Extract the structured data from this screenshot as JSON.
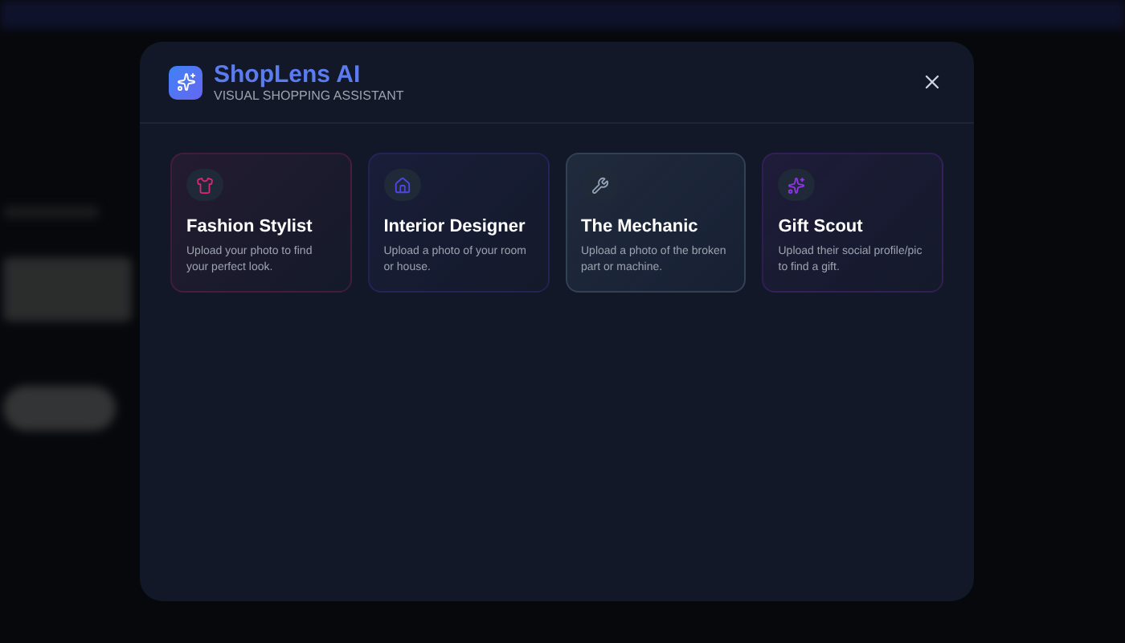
{
  "modal": {
    "title": "ShopLens AI",
    "subtitle": "VISUAL SHOPPING ASSISTANT"
  },
  "modes": [
    {
      "kind": "shirt",
      "title": "Fashion Stylist",
      "description": "Upload your photo to find your perfect look.",
      "color": "#db2777",
      "selected": false
    },
    {
      "kind": "house",
      "title": "Interior Designer",
      "description": "Upload a photo of your room or house.",
      "color": "#4f46e5",
      "selected": false
    },
    {
      "kind": "wrench",
      "title": "The Mechanic",
      "description": "Upload a photo of the broken part or machine.",
      "color": "#94a3b8",
      "selected": true
    },
    {
      "kind": "sparkles",
      "title": "Gift Scout",
      "description": "Upload their social profile/pic to find a gift.",
      "color": "#9333ea",
      "selected": false
    }
  ]
}
